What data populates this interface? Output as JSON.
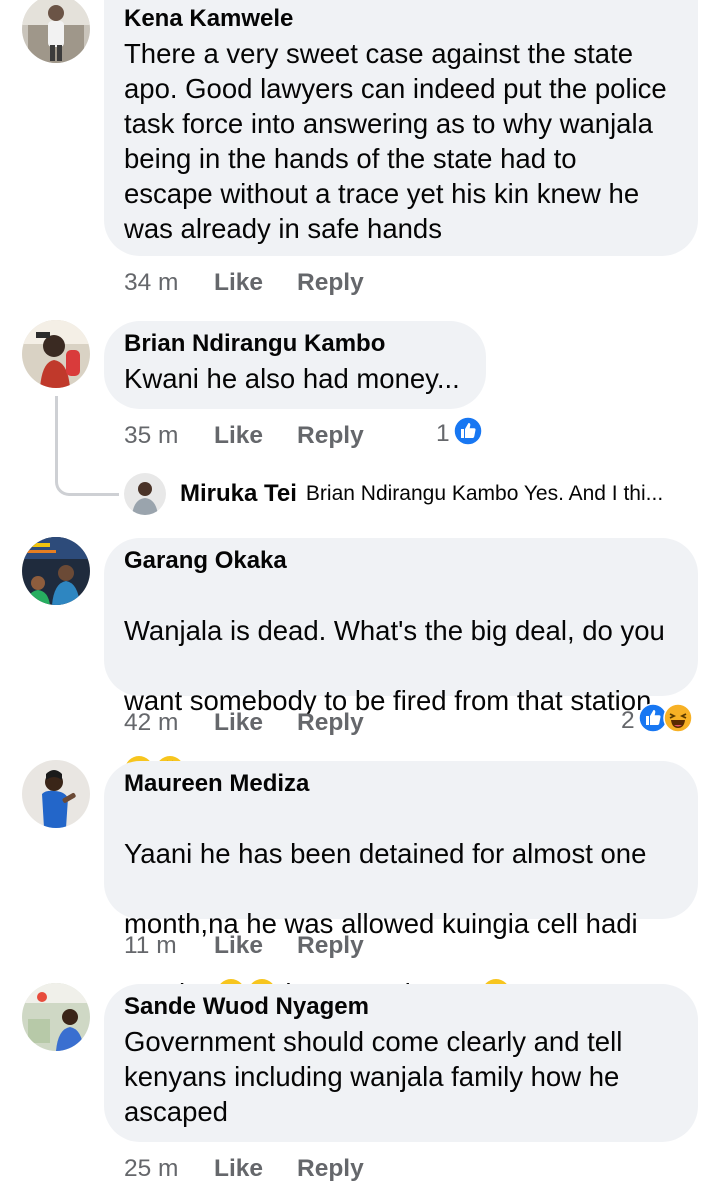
{
  "comments": [
    {
      "author": "Kena Kamwele",
      "text": "There a very sweet case against the state\napo. Good lawyers can indeed put the police\ntask force into answering as to why wanjala\nbeing in the hands of the state had to\nescape without a trace yet his kin knew he\nwas already in safe hands",
      "time": "34 m",
      "like_label": "Like",
      "reply_label": "Reply"
    },
    {
      "author": "Brian Ndirangu Kambo",
      "text": "Kwani he also had money...",
      "time": "35 m",
      "like_label": "Like",
      "reply_label": "Reply",
      "reaction_count": "1",
      "reaction_icons": [
        "like-reaction-icon"
      ],
      "reply_preview": {
        "author": "Miruka Tei",
        "text": "Brian Ndirangu Kambo Yes. And I thi..."
      }
    },
    {
      "author": "Garang Okaka",
      "text_lines": [
        "Wanjala is dead. What's the big deal, do you",
        "want somebody to be fired from that station"
      ],
      "text_tail": "!",
      "text_emojis": [
        "sunglasses-emoji-icon",
        "thinking-emoji-icon"
      ],
      "time": "42 m",
      "like_label": "Like",
      "reply_label": "Reply",
      "reaction_count": "2",
      "reaction_icons": [
        "like-reaction-icon",
        "haha-reaction-icon"
      ]
    },
    {
      "author": "Maureen Mediza",
      "text_lines": [
        "Yaani he has been detained for almost one",
        "month,na he was allowed kuingia cell hadi"
      ],
      "text_last_start": "na  doo",
      "text_last_mid": ".kenya to the top",
      "text_emojis": [
        "eye-roll-emoji-icon",
        "eye-roll-emoji-icon",
        "zany-face-emoji-icon"
      ],
      "time": "11 m",
      "like_label": "Like",
      "reply_label": "Reply"
    },
    {
      "author": "Sande Wuod Nyagem",
      "text": "Government should come clearly and tell\nkenyans including wanjala family how he\nascaped",
      "time": "25 m",
      "like_label": "Like",
      "reply_label": "Reply"
    }
  ],
  "colors": {
    "bubble": "#f0f2f5",
    "meta_text": "#65676b",
    "like_blue": "#1877f2",
    "thread_line": "#ced0d4"
  }
}
